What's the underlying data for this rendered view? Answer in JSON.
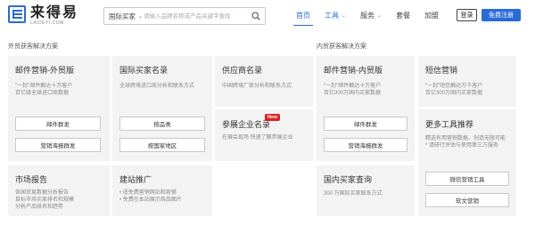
{
  "header": {
    "logo_cn": "来得易",
    "logo_en": "LAIDEYI.COM",
    "search": {
      "category": "国际买家",
      "placeholder": "请输入品牌名称或产品关键字查找"
    },
    "nav": [
      {
        "label": "首页",
        "active": true,
        "dropdown": false
      },
      {
        "label": "工具",
        "active": false,
        "dropdown": true
      },
      {
        "label": "服务",
        "active": false,
        "dropdown": true
      },
      {
        "label": "套餐",
        "active": false,
        "dropdown": false
      },
      {
        "label": "加盟",
        "active": false,
        "dropdown": false
      }
    ],
    "login_label": "登录",
    "register_label": "免费注册"
  },
  "sections": {
    "foreign": "外贸获客解决方案",
    "domestic": "内贸获客解决方案"
  },
  "cards": {
    "email_foreign": {
      "title": "邮件营销-外贸版",
      "desc": [
        "\"一封\"邮件触达十万客户",
        "百亿级全球进口商数据"
      ],
      "buttons": [
        "邮件群发",
        "营销海报群发"
      ]
    },
    "intl_buyers": {
      "title": "国际买家名录",
      "desc": [
        "全球跨境进口商分析和联系方式"
      ],
      "buttons": [
        "按品类",
        "按国家地区"
      ]
    },
    "supplier": {
      "title": "供应商名录",
      "desc": [
        "中国跨境厂家分析和联系方式"
      ]
    },
    "expo": {
      "title": "参展企业名录",
      "badge": "New",
      "desc": [
        "在展会现场 快速了解参展企业"
      ]
    },
    "email_domestic": {
      "title": "邮件营销-内贸版",
      "desc": [
        "\"一封\"邮件触达十万客户",
        "百亿300万国内买家数据"
      ],
      "buttons": [
        "邮件群发",
        "营销海报群发"
      ]
    },
    "sms": {
      "title": "短信营销",
      "desc": [
        "\"一封\"短信触达万千客户",
        "百亿300万国内买家数据"
      ]
    },
    "more_tools": {
      "title": "更多工具推荐",
      "desc": [
        "精选有用营销数据，创造无限可能",
        "* 请研行评估与使用第三方服务"
      ],
      "buttons": [
        "微信营销工具",
        "软文营销"
      ]
    },
    "market_report": {
      "title": "市场报告",
      "desc": [
        "各国贸易数据分析报告",
        "目标市场买家排名和规模",
        "分析产品排名和趋势"
      ]
    },
    "site_promo": {
      "title": "建站推广",
      "desc": [
        "• 适免费营销网站和商铺",
        "• 免费在本站展示商品图片"
      ]
    },
    "domestic_buyers": {
      "title": "国内买家查询",
      "desc": [
        "300 万国际买家联系方式"
      ]
    }
  },
  "colors": {
    "brand_blue": "#2a6bd8",
    "badge_red": "#e02020",
    "card_bg": "#f3f3f3"
  }
}
